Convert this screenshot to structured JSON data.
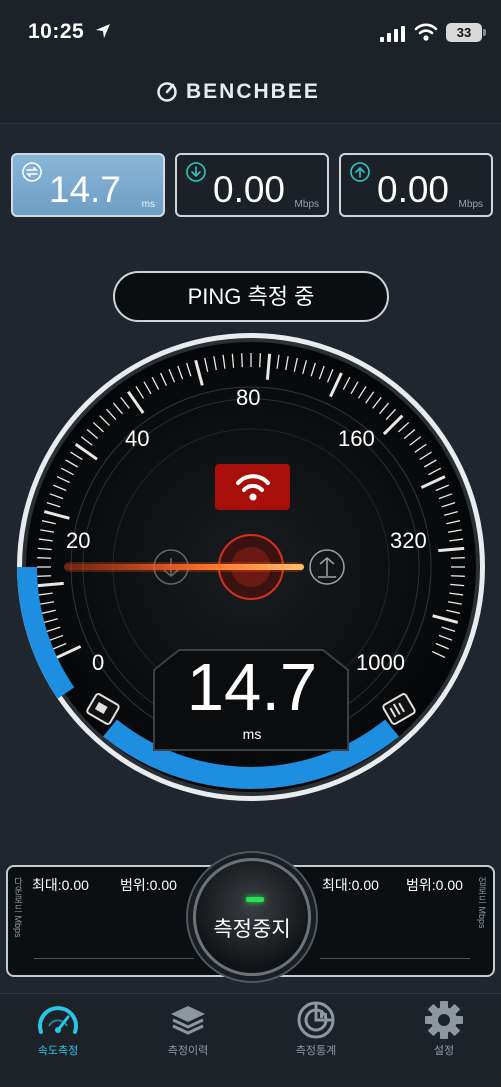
{
  "status_bar": {
    "time": "10:25",
    "battery": "33"
  },
  "header": {
    "brand": "BENCHBEE"
  },
  "stats": [
    {
      "icon": "ping-icon",
      "value": "14.7",
      "unit": "ms"
    },
    {
      "icon": "download-icon",
      "value": "0.00",
      "unit": "Mbps"
    },
    {
      "icon": "upload-icon",
      "value": "0.00",
      "unit": "Mbps"
    }
  ],
  "status_text": "PING 측정 중",
  "gauge": {
    "labels": [
      "0",
      "20",
      "40",
      "80",
      "160",
      "320",
      "1000"
    ],
    "value": "14.7",
    "unit": "ms",
    "colors": {
      "accent": "#1e8ee0",
      "needle": "#ff9a3c",
      "wifi_badge": "#a80f0a"
    }
  },
  "graph": {
    "left_side": "다운로드 Mbps",
    "right_side": "업로드 Mbps",
    "left_max": "최대:0.00",
    "left_range": "범위:0.00",
    "right_max": "최대:0.00",
    "right_range": "범위:0.00"
  },
  "stop_button": "측정중지",
  "tabs": [
    {
      "label": "속도측정",
      "icon": "speedometer-icon",
      "active": true
    },
    {
      "label": "측정이력",
      "icon": "layers-icon",
      "active": false
    },
    {
      "label": "측정통계",
      "icon": "stats-icon",
      "active": false
    },
    {
      "label": "설정",
      "icon": "gear-icon",
      "active": false
    }
  ]
}
